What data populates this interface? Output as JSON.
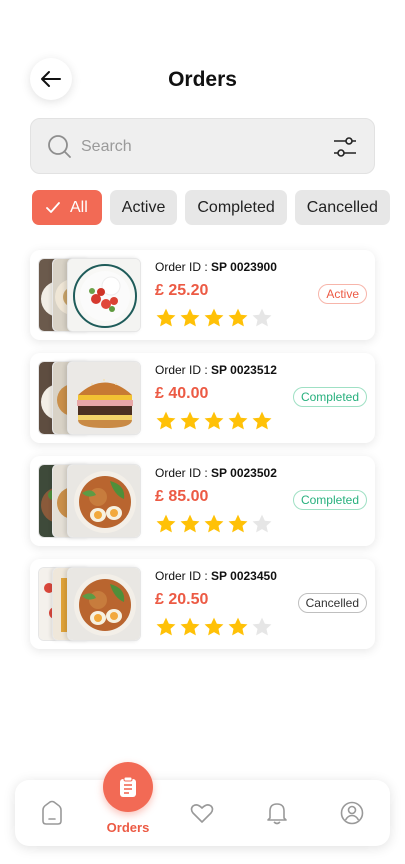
{
  "header": {
    "title": "Orders",
    "back_icon": "arrow-left-icon"
  },
  "search": {
    "placeholder": "Search",
    "value": "",
    "icon": "search-icon",
    "filter_icon": "sliders-icon"
  },
  "tabs": [
    {
      "label": "All",
      "selected": true
    },
    {
      "label": "Active",
      "selected": false
    },
    {
      "label": "Completed",
      "selected": false
    },
    {
      "label": "Cancelled",
      "selected": false
    }
  ],
  "orders": [
    {
      "id_label": "Order ID :",
      "id": "SP 0023900",
      "price": "£ 25.20",
      "rating": 4,
      "status": "Active",
      "status_type": "active",
      "image": "salad"
    },
    {
      "id_label": "Order ID :",
      "id": "SP 0023512",
      "price": "£ 40.00",
      "rating": 5,
      "status": "Completed",
      "status_type": "completed",
      "image": "burger"
    },
    {
      "id_label": "Order ID :",
      "id": "SP 0023502",
      "price": "£ 85.00",
      "rating": 4,
      "status": "Completed",
      "status_type": "completed",
      "image": "bowl"
    },
    {
      "id_label": "Order ID :",
      "id": "SP 0023450",
      "price": "£ 20.50",
      "rating": 4,
      "status": "Cancelled",
      "status_type": "cancelled",
      "image": "bowl"
    }
  ],
  "nav": {
    "items": [
      {
        "name": "home",
        "icon": "home-icon"
      },
      {
        "name": "orders",
        "icon": "clipboard-icon",
        "label": "Orders",
        "selected": true
      },
      {
        "name": "favorites",
        "icon": "heart-icon"
      },
      {
        "name": "notifications",
        "icon": "bell-icon"
      },
      {
        "name": "profile",
        "icon": "user-icon"
      }
    ]
  },
  "colors": {
    "accent": "#f26a55",
    "price": "#ec5a44",
    "star": "#ffc107",
    "star_empty": "#e6e6e6",
    "completed": "#27b07d"
  }
}
